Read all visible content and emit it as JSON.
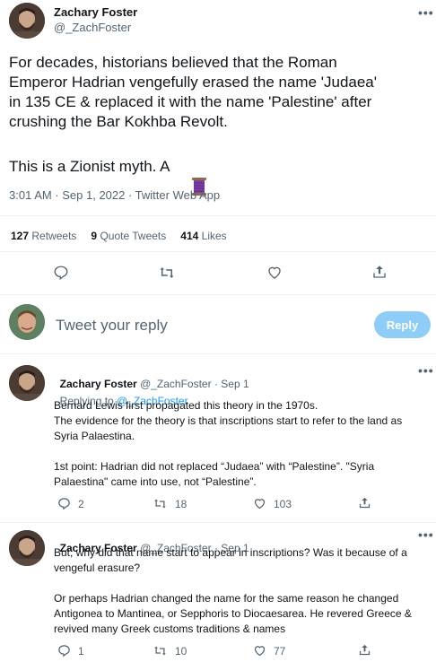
{
  "main_tweet": {
    "author_name": "Zachary Foster",
    "author_handle": "@_ZachFoster",
    "text_lines": [
      "For decades, historians believed that the Roman",
      "Emperor Hadrian vengefully erased the name 'Judaea'",
      "in 135 CE & replaced it with the name 'Palestine' after",
      "crushing the Bar Kokhba Revolt."
    ],
    "text2": "This is a Zionist myth. A ",
    "emoji_icon": "thread-spool-icon",
    "meta": "3:01 AM · Sep 1, 2022 · Twitter Web App",
    "stats": {
      "retweets_count": "127",
      "retweets_label": "Retweets",
      "quotes_count": "9",
      "quotes_label": "Quote Tweets",
      "likes_count": "414",
      "likes_label": "Likes"
    }
  },
  "compose": {
    "placeholder": "Tweet your reply",
    "reply_button": "Reply"
  },
  "replies": [
    {
      "author_name": "Zachary Foster",
      "author_handle": "@_ZachFoster",
      "dot": "·",
      "date": "Sep 1",
      "replying_prefix": "Replying to ",
      "replying_handle": "@_ZachFoster",
      "lines": [
        "Bernard Lewis first propagated this theory in the 1970s.",
        "The evidence for the theory is that inscriptions start to refer to the land as",
        "Syria Palaestina.",
        "",
        "1st point: Hadrian did not replaced “Judaea” with “Palestine”. \"Syria",
        "Palaestina\" came into use, not “Palestine”."
      ],
      "replies_count": "2",
      "retweets_count": "18",
      "likes_count": "103"
    },
    {
      "author_name": "Zachary Foster",
      "author_handle": "@_ZachFoster",
      "dot": "·",
      "date": "Sep 1",
      "lines": [
        "But, why did that name start to appear in inscriptions? Was it because of a",
        "vengeful erasure?",
        "",
        "Or perhaps Hadrian changed the name for the same reason he changed",
        "Antigonea to Mantinea, or Sepphoris to Diocaesarea. He revered Greece &",
        "revived many Greek customs traditions & names"
      ],
      "replies_count": "1",
      "retweets_count": "10",
      "likes_count": "77"
    }
  ],
  "more_label": "•••",
  "colors": {
    "accent": "#1d9bf0",
    "reply_disabled": "#8ecdf8",
    "muted": "#536471",
    "divider": "#eff3f4"
  }
}
